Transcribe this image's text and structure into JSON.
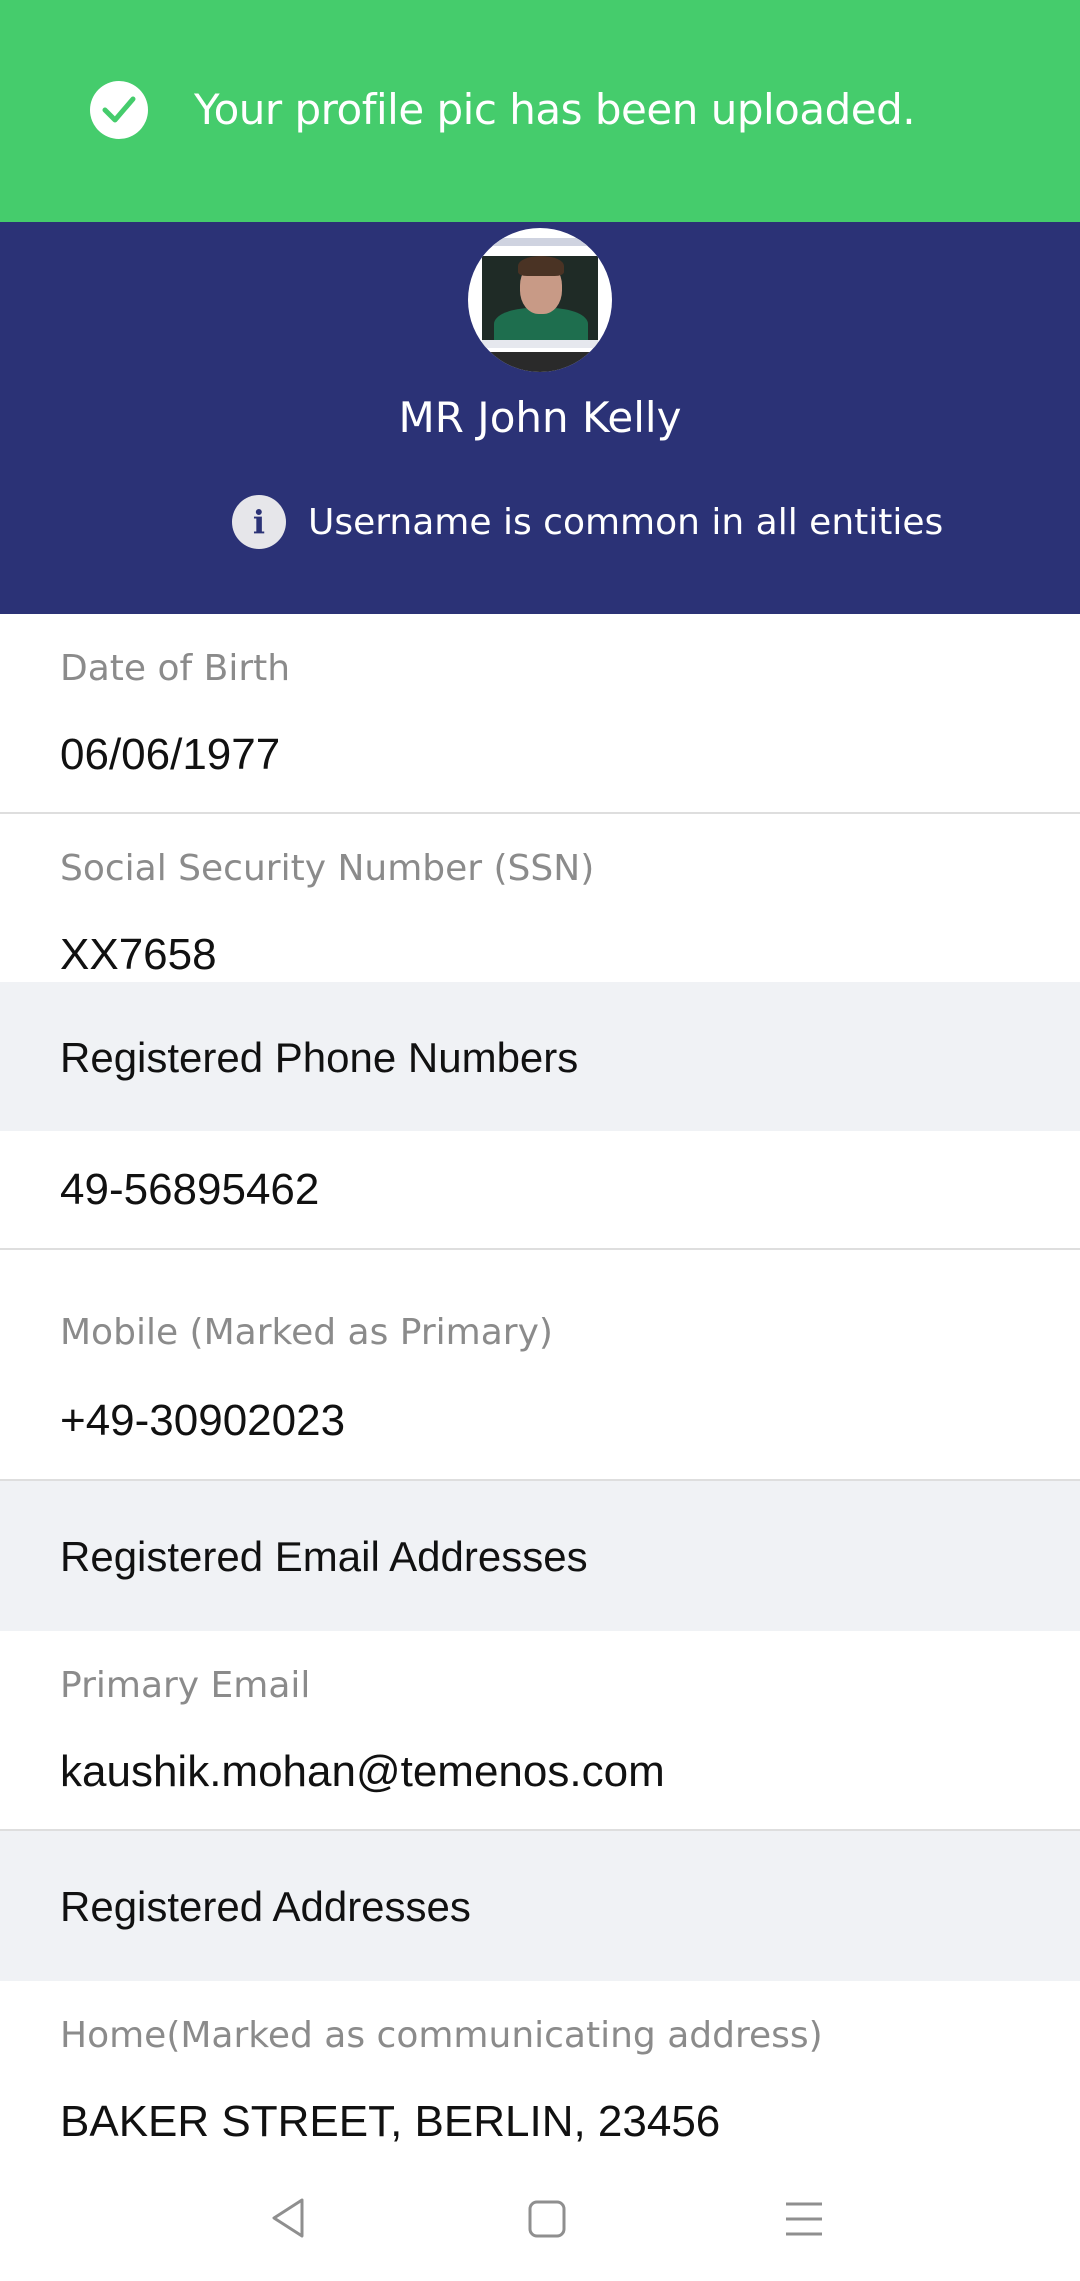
{
  "toast": {
    "message": "Your profile pic has been uploaded.",
    "icon": "check-circle-icon",
    "color": "#45cc6c"
  },
  "profile": {
    "name": "MR John Kelly",
    "info_text": "Username is common in all entities",
    "info_icon": "info-icon",
    "header_color": "#2b3276"
  },
  "details": {
    "dob_label": "Date of Birth",
    "dob_value": "06/06/1977",
    "ssn_label": "Social Security Number (SSN)",
    "ssn_value": "XX7658"
  },
  "phones": {
    "section_title": "Registered Phone Numbers",
    "landline_value": "49-56895462",
    "mobile_label": "Mobile (Marked as Primary)",
    "mobile_value": "+49-30902023"
  },
  "emails": {
    "section_title": "Registered Email Addresses",
    "primary_label": "Primary Email",
    "primary_value": "kaushik.mohan@temenos.com"
  },
  "addresses": {
    "section_title": "Registered Addresses",
    "home_label": "Home(Marked as communicating address)",
    "home_value": "BAKER STREET, BERLIN, 23456"
  },
  "navbar": {
    "back_icon": "back-triangle-icon",
    "home_icon": "home-square-icon",
    "menu_icon": "menu-lines-icon"
  }
}
